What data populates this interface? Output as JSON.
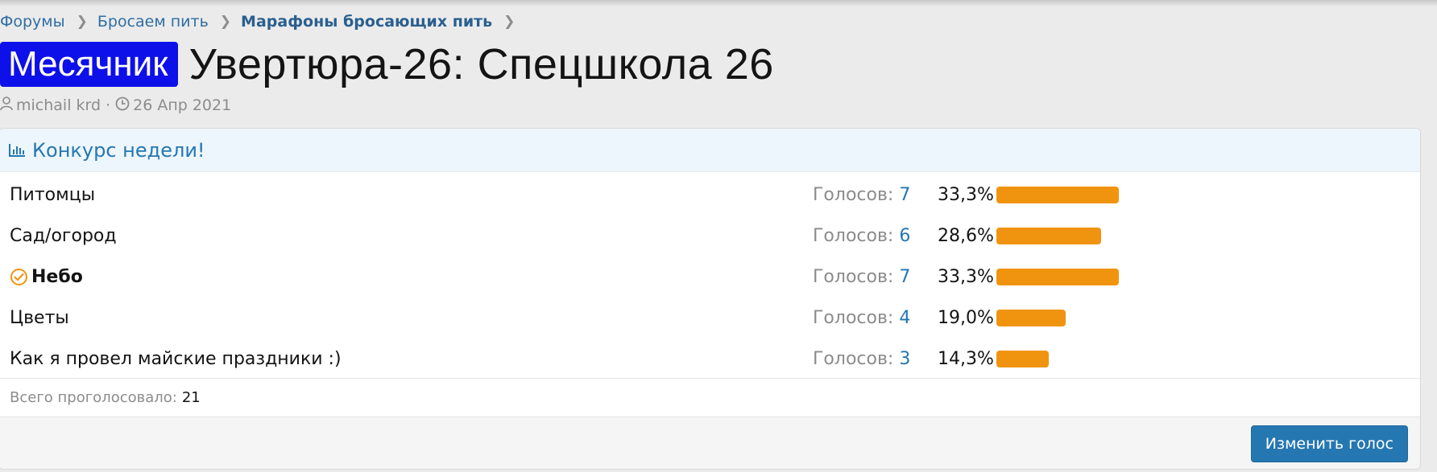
{
  "breadcrumb": {
    "items": [
      "Форумы",
      "Бросаем пить",
      "Марафоны бросающих пить"
    ]
  },
  "thread": {
    "prefix": "Месячник",
    "title": "Увертюра-26: Спецшкола 26",
    "author": "michail krd",
    "date": "26 Апр 2021",
    "prefix_color": "#0e10ea"
  },
  "poll": {
    "title": "Конкурс недели!",
    "votes_label": "Голосов:",
    "bar_color": "#f0940f",
    "options": [
      {
        "label": "Питомцы",
        "votes": "7",
        "percent_text": "33,3%",
        "fill": 0.333,
        "voted": false
      },
      {
        "label": "Сад/огород",
        "votes": "6",
        "percent_text": "28,6%",
        "fill": 0.286,
        "voted": false
      },
      {
        "label": "Небо",
        "votes": "7",
        "percent_text": "33,3%",
        "fill": 0.333,
        "voted": true
      },
      {
        "label": "Цветы",
        "votes": "4",
        "percent_text": "19,0%",
        "fill": 0.19,
        "voted": false
      },
      {
        "label": "Как я провел майские праздники :)",
        "votes": "3",
        "percent_text": "14,3%",
        "fill": 0.143,
        "voted": false
      }
    ],
    "total_label": "Всего проголосовало:",
    "total_value": "21",
    "change_vote_label": "Изменить голос"
  },
  "icons": {
    "author": "user-icon",
    "date": "clock-icon",
    "poll": "bar-chart-icon",
    "voted": "check-circle-icon",
    "separator": "chevron-right-icon"
  }
}
